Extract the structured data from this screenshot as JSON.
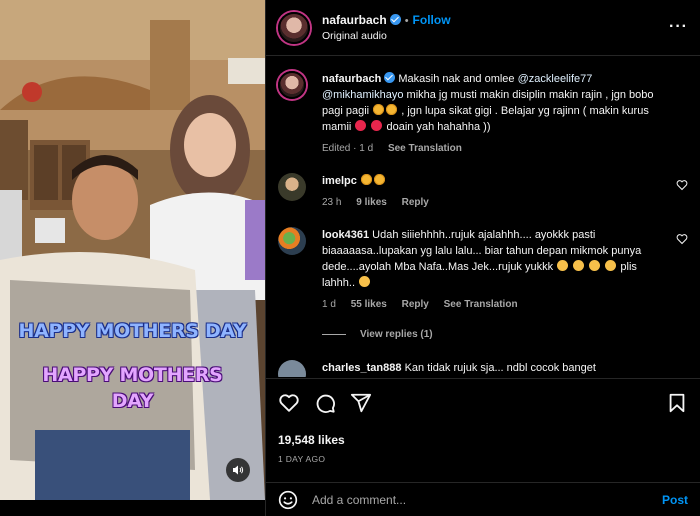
{
  "header": {
    "username": "nafaurbach",
    "dot": "•",
    "follow_label": "Follow",
    "subtitle": "Original audio",
    "more_label": "···"
  },
  "video": {
    "overlay_line1": "HAPPY MOTHERS DAY",
    "overlay_line2a": "HAPPY MOTHERS",
    "overlay_line2b": "DAY"
  },
  "caption": {
    "username": "nafaurbach",
    "text_part1": "Makasih nak and omlee ",
    "mention1": "@zackleelife77",
    "mention2": "@mikhamikhayo",
    "text_part2": " mikha jg musti makin disiplin makin rajin , jgn bobo pagi pagii ",
    "text_part3": " , jgn lupa sikat gigi . Belajar yg rajinn ( makin kurus mamii ",
    "text_part4": " doain yah hahahha ))",
    "meta_edited": "Edited · 1 d",
    "meta_translate": "See Translation"
  },
  "comments": [
    {
      "username": "imelpc",
      "time": "23 h",
      "likes": "9 likes",
      "reply": "Reply"
    },
    {
      "username": "look4361",
      "text": "Udah siiiehhhh..rujuk ajalahhh.... ayokkk pasti biaaaaasa..lupakan yg lalu lalu... biar tahun depan mikmok punya dede....ayolah Mba Nafa..Mas Jek...rujuk yukkk",
      "text_tail": "plis lahhh..",
      "time": "1 d",
      "likes": "55 likes",
      "reply": "Reply",
      "translate": "See Translation",
      "view_replies": "View replies (1)"
    },
    {
      "username": "charles_tan888",
      "text": "Kan tidak rujuk sja... ndbl cocok banget"
    }
  ],
  "actions": {
    "likes_count": "19,548 likes",
    "date": "1 DAY AGO"
  },
  "add_comment": {
    "placeholder": "Add a comment...",
    "post_label": "Post"
  },
  "colors": {
    "accent": "#0095f6",
    "background": "#000000",
    "muted": "#a8a8a8",
    "divider": "#262626"
  }
}
